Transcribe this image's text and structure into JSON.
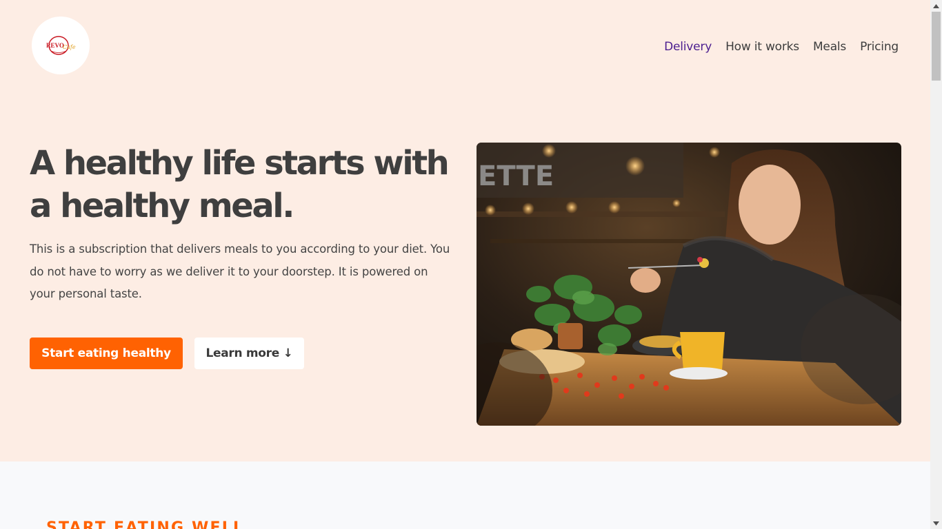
{
  "brand": {
    "logo_text": "REVO",
    "logo_script": "Cafe",
    "logo_icon": "plate-logo-icon"
  },
  "nav": {
    "items": [
      {
        "label": "Delivery",
        "active": true
      },
      {
        "label": "How it works",
        "active": false
      },
      {
        "label": "Meals",
        "active": false
      },
      {
        "label": "Pricing",
        "active": false
      }
    ]
  },
  "hero": {
    "headline": "A healthy life starts with a healthy meal.",
    "description": "This is a subscription that delivers meals to you according to your diet. You do not have to worry as we deliver it to your doorstep. It is powered on your personal taste.",
    "primary_cta": "Start eating healthy",
    "secondary_cta": "Learn more ↓",
    "image": "woman-eating-salad-in-cafe-photo"
  },
  "next_section": {
    "label": "START EATING WELL"
  },
  "colors": {
    "hero_background": "#fdede4",
    "accent": "#ff6202",
    "nav_active": "#4b1d8f",
    "text": "#3f3f3f",
    "page_background": "#f8f9fb"
  },
  "scrollbar": {
    "up_icon": "triangle-up-icon",
    "down_icon": "triangle-down-icon"
  }
}
